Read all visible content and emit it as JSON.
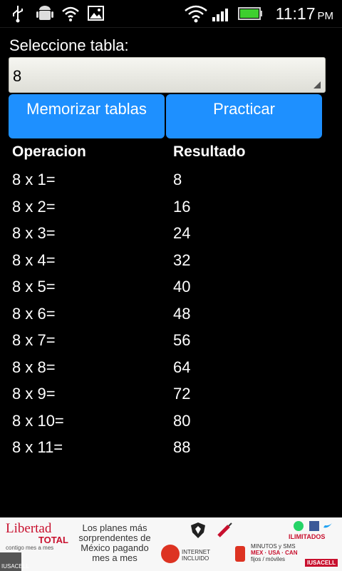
{
  "status_bar": {
    "time": "11:17",
    "ampm": "PM",
    "icons": [
      "usb-icon",
      "android-icon",
      "wifi-icon",
      "image-icon",
      "wifi-signal-icon",
      "cell-signal-icon",
      "battery-icon"
    ]
  },
  "selector": {
    "label": "Seleccione tabla:",
    "value": "8"
  },
  "buttons": {
    "memorize": "Memorizar tablas",
    "practice": "Practicar"
  },
  "table": {
    "headers": [
      "Operacion",
      "Resultado"
    ],
    "rows": [
      {
        "op": "8 x 1=",
        "res": "8"
      },
      {
        "op": "8 x 2=",
        "res": "16"
      },
      {
        "op": "8 x 3=",
        "res": "24"
      },
      {
        "op": "8 x 4=",
        "res": "32"
      },
      {
        "op": "8 x 5=",
        "res": "40"
      },
      {
        "op": "8 x 6=",
        "res": "48"
      },
      {
        "op": "8 x 7=",
        "res": "56"
      },
      {
        "op": "8 x 8=",
        "res": "64"
      },
      {
        "op": "8 x 9=",
        "res": "72"
      },
      {
        "op": "8 x 10=",
        "res": "80"
      },
      {
        "op": "8 x 11=",
        "res": "88"
      }
    ]
  },
  "ad": {
    "brand_line1": "Libertad",
    "brand_line2": "TOTAL",
    "brand_line3": "contigo mes a mes",
    "text": "Los planes más sorprendentes de México pagando mes a mes",
    "internet_line1": "INTERNET",
    "internet_line2": "INCLUIDO",
    "minutes_line1": "MINUTOS y SMS",
    "minutes_line2": "MEX · USA · CAN",
    "minutes_line3": "fijos / móviles",
    "ilimitados": "ILIMITADOS",
    "carrier": "IUSACELL",
    "badge": "IUSACELL"
  },
  "colors": {
    "button": "#1e90ff",
    "background": "#000000",
    "ad_red": "#c8102e"
  }
}
